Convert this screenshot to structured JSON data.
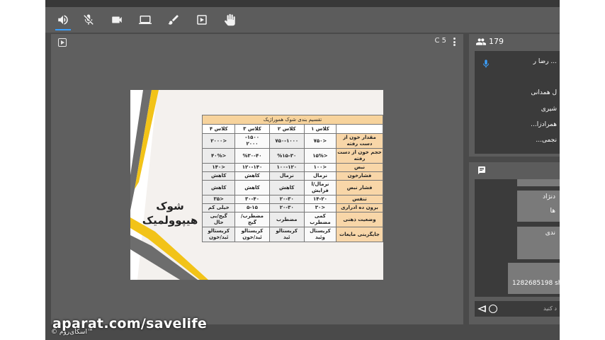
{
  "toolbar": {
    "icons": [
      "speaker-icon",
      "mic-muted-icon",
      "camera-icon",
      "screen-share-icon",
      "brush-icon",
      "play-media-icon",
      "raise-hand-icon"
    ]
  },
  "stage": {
    "count_label": "C 5"
  },
  "slide": {
    "title_line1": "شوک",
    "title_line2": "هیپوولمیک",
    "table": {
      "caption": "تقسیم بندی شوک هموراژیک",
      "columns": [
        "کلاس ۱",
        "کلاس ۲",
        "کلاس ۳",
        "کلاس ۴"
      ],
      "rows": [
        {
          "label": "مقدار خون از دست رفته",
          "values": [
            "<۷۵۰",
            "۷۵۰-۱۰۰۰",
            "۱۵۰۰-\n۲۰۰۰",
            "<۲۰۰۰"
          ]
        },
        {
          "label": "حجم خون از دست رفته",
          "values": [
            "<۱۵%",
            "%۱۵-۳۰",
            "%۳۰-۴۰",
            "<۴۰%"
          ]
        },
        {
          "label": "نبض",
          "values": [
            "<۱۰۰",
            "۱۰۰-۱۲۰",
            "۱۲۰-۱۴۰",
            "<۱۴۰"
          ]
        },
        {
          "label": "فشارخون",
          "values": [
            "نرمال",
            "نرمال",
            "کاهش",
            "کاهش"
          ]
        },
        {
          "label": "فشار نبض",
          "values": [
            "نرمال/ا\nفزایش",
            "کاهش",
            "کاهش",
            "کاهش"
          ]
        },
        {
          "label": "تنفس",
          "values": [
            "۱۴-۲۰",
            "۲۰-۳۰",
            "۳۰-۴۰",
            "<۳۵"
          ]
        },
        {
          "label": "برون ده ادراری",
          "values": [
            "<۳۰",
            "۲۰-۳۰",
            "۵-۱۵",
            "خیلی کم"
          ]
        },
        {
          "label": "وضعیت ذهنی",
          "values": [
            "کمی\nمضطرب",
            "مضطرب",
            "مضطرب/\nگیج",
            "گیج/بی\nحال"
          ]
        },
        {
          "label": "جایگزینی مایعات",
          "values": [
            "کریستال\nوئید",
            "کریستالو\nئید",
            "کریستالو\nئید/خون",
            "کریستالو\nئید/خون"
          ]
        }
      ]
    }
  },
  "watermark": {
    "main": "aparat.com/savelife",
    "sub": "© اسکای‌روم™"
  },
  "users": {
    "count": "179",
    "list": [
      "... رضا ر",
      "ل همدانی",
      "شیری",
      "همرادزا...",
      "نجمی..."
    ]
  },
  "chat": {
    "messages": [
      "دنژاد",
      "ها",
      "ندی",
      "1282685198 sh"
    ],
    "placeholder": "د کنید"
  },
  "colors": {
    "accent_yellow": "#f2c318",
    "accent_gray": "#6d6d6d",
    "header_orange": "#f7d39c",
    "active_blue": "#3aa0ff"
  }
}
